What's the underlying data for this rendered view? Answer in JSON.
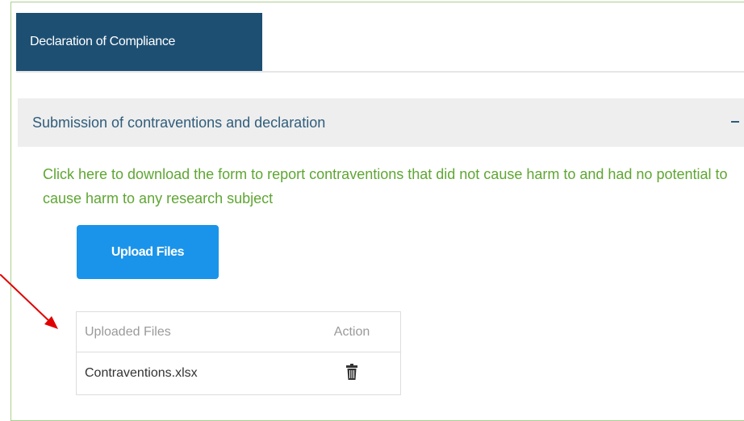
{
  "tabs": {
    "active_label": "Declaration of Compliance"
  },
  "accordion": {
    "title": "Submission of contraventions and declaration",
    "toggle_icon": "minus-icon"
  },
  "download_link": {
    "text": "Click here to download the form to report contraventions that did not cause harm to and had no potential to cause harm to any research subject"
  },
  "upload": {
    "label": "Upload Files"
  },
  "files_table": {
    "headers": [
      "Uploaded Files",
      "Action"
    ],
    "rows": [
      {
        "file_name": "Contraventions.xlsx",
        "action_icon": "trash-icon"
      }
    ]
  },
  "annotation": {
    "arrow_color": "#e00000"
  },
  "colors": {
    "tab_active_bg": "#1d4f73",
    "link_green": "#5fa633",
    "button_blue": "#1a94ea",
    "frame_border": "#a9d18e"
  }
}
